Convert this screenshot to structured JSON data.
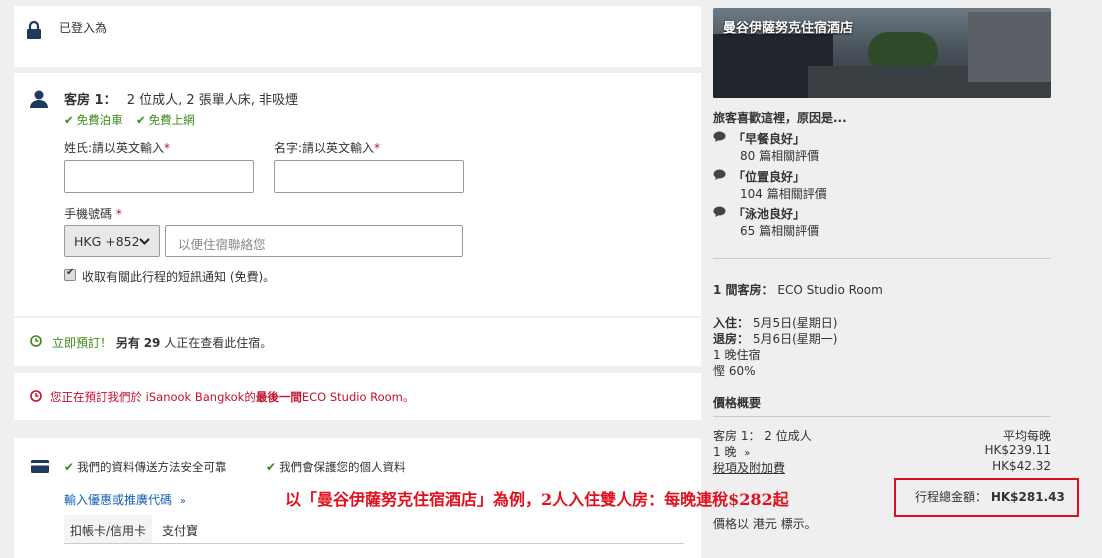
{
  "login": {
    "label": "已登入為"
  },
  "room": {
    "title_prefix": "客房 1：",
    "title_desc": "2 位成人, 2 張單人床, 非吸煙",
    "perks": [
      "免費泊車",
      "免費上網"
    ],
    "last_name_label": "姓氏:請以英文輸入",
    "first_name_label": "名字:請以英文輸入",
    "required_mark": "*",
    "phone_label": "手機號碼",
    "country_code": "HKG +852",
    "phone_placeholder": "以便住宿聯絡您",
    "sms_label": "收取有關此行程的短訊通知 (免費)。"
  },
  "urgency": {
    "book_now": "立即預訂！",
    "prefix": "另有",
    "count": "29",
    "suffix": "人正在查看此住宿。"
  },
  "warning": {
    "prefix": "您正在預訂我們於 iSanook Bangkok的",
    "bold": "最後一間",
    "suffix": "ECO Studio Room。"
  },
  "payment": {
    "secure1": "我們的資料傳送方法安全可靠",
    "secure2": "我們會保護您的個人資料",
    "promo_link": "輸入優惠或推廣代碼",
    "tabs": [
      "扣帳卡/信用卡",
      "支付寶"
    ]
  },
  "annotation": "以「曼谷伊薩努克住宿酒店」為例，2人入住雙人房：每晚連稅$282起",
  "hotel": {
    "name": "曼谷伊薩努克住宿酒店",
    "why_title": "旅客喜歡這裡，原因是...",
    "reasons": [
      {
        "title": "「早餐良好」",
        "count": "80 篇相關評價"
      },
      {
        "title": "「位置良好」",
        "count": "104 篇相關評價"
      },
      {
        "title": "「泳池良好」",
        "count": "65 篇相關評價"
      }
    ]
  },
  "summary": {
    "rooms_label": "1 間客房：",
    "room_name": "ECO Studio Room",
    "checkin_label": "入住：",
    "checkin_date": "5月5日(星期日)",
    "checkout_label": "退房：",
    "checkout_date": "5月6日(星期一)",
    "nights": "1 晚住宿",
    "discount": "慳 60%",
    "price_overview": "價格概要",
    "room_guests": "客房 1： 2 位成人",
    "avg_nightly": "平均每晚",
    "nights_link": "1 晚",
    "nightly_price": "HK$239.11",
    "taxes_link": "稅項及附加費",
    "taxes_price": "HK$42.32",
    "total_label": "行程總金額：",
    "total_price": "HK$281.43",
    "currency_note": "價格以 港元 標示。"
  },
  "colors": {
    "accent_blue": "#1560b8",
    "green": "#3a8a1a",
    "red": "#c8102e"
  }
}
